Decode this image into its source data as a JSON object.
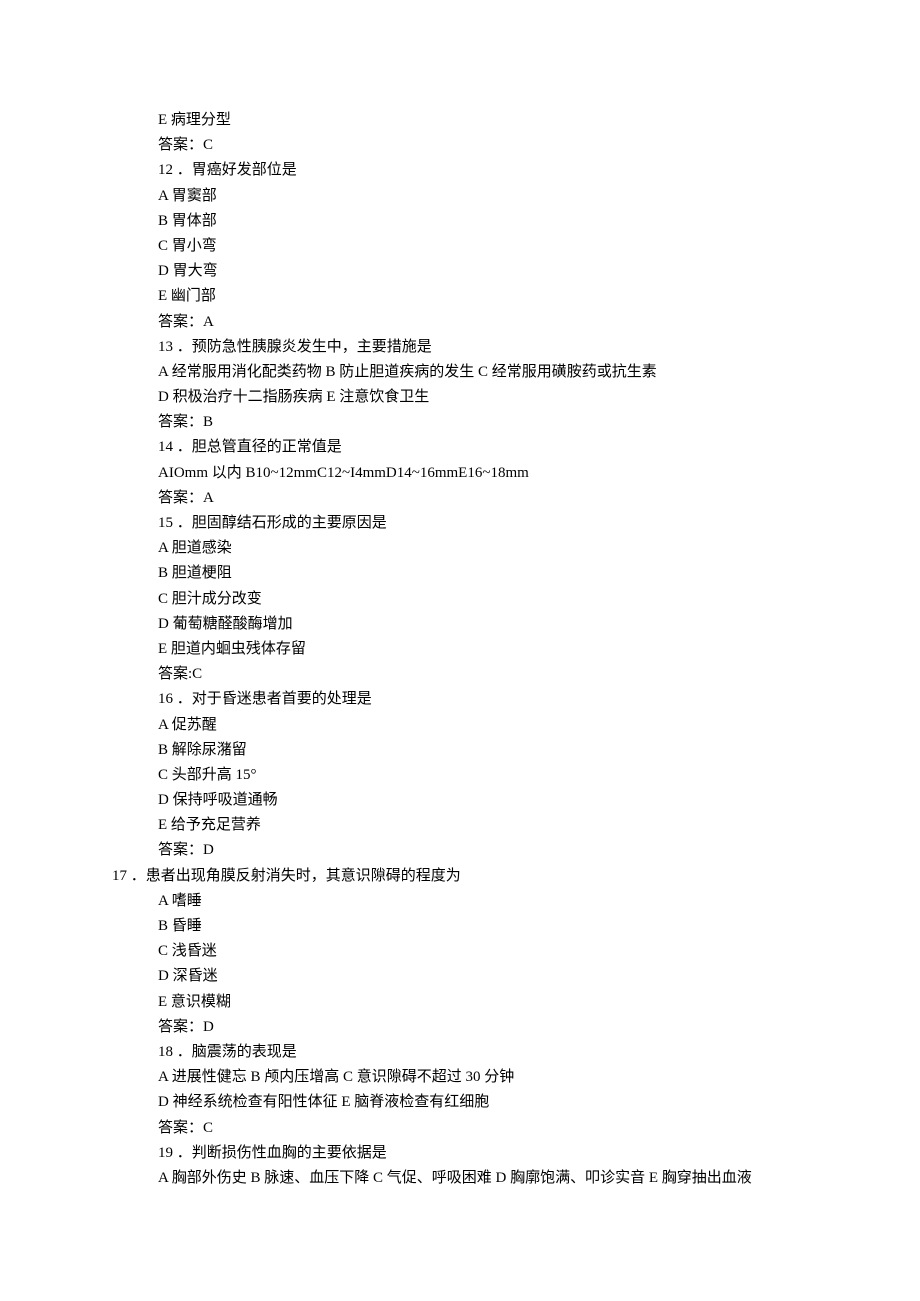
{
  "lines": [
    {
      "text": "E 病理分型",
      "outdent": false
    },
    {
      "text": "答案：C",
      "outdent": false
    },
    {
      "text": "12 ．胃癌好发部位是",
      "outdent": false
    },
    {
      "text": "A 胃窦部",
      "outdent": false
    },
    {
      "text": "B 胃体部",
      "outdent": false
    },
    {
      "text": "C 胃小弯",
      "outdent": false
    },
    {
      "text": "D 胃大弯",
      "outdent": false
    },
    {
      "text": "E 幽门部",
      "outdent": false
    },
    {
      "text": "答案：A",
      "outdent": false
    },
    {
      "text": "13 ．预防急性胰腺炎发生中，主要措施是",
      "outdent": false
    },
    {
      "text": "A 经常服用消化配类药物 B 防止胆道疾病的发生 C 经常服用磺胺药或抗生素",
      "outdent": false
    },
    {
      "text": "D 积极治疗十二指肠疾病 E 注意饮食卫生",
      "outdent": false
    },
    {
      "text": "答案：B",
      "outdent": false
    },
    {
      "text": "14 ．胆总管直径的正常值是",
      "outdent": false
    },
    {
      "text": "AIOmm 以内 B10~12mmC12~I4mmD14~16mmE16~18mm",
      "outdent": false
    },
    {
      "text": "答案：A",
      "outdent": false
    },
    {
      "text": "15 ．胆固醇结石形成的主要原因是",
      "outdent": false
    },
    {
      "text": "A 胆道感染",
      "outdent": false
    },
    {
      "text": "B 胆道梗阻",
      "outdent": false
    },
    {
      "text": "C 胆汁成分改变",
      "outdent": false
    },
    {
      "text": "D 葡萄糖醛酸酶增加",
      "outdent": false
    },
    {
      "text": "E 胆道内蛔虫残体存留",
      "outdent": false
    },
    {
      "text": "答案:C",
      "outdent": false
    },
    {
      "text": "16 ．对于昏迷患者首要的处理是",
      "outdent": false
    },
    {
      "text": "A 促苏醒",
      "outdent": false
    },
    {
      "text": "B 解除尿潴留",
      "outdent": false
    },
    {
      "text": "C 头部升高 15°",
      "outdent": false
    },
    {
      "text": "D 保持呼吸道通畅",
      "outdent": false
    },
    {
      "text": "E 给予充足营养",
      "outdent": false
    },
    {
      "text": "答案：D",
      "outdent": false
    },
    {
      "text": "17 ．患者出现角膜反射消失时，其意识隙碍的程度为",
      "outdent": true
    },
    {
      "text": "A 嗜睡",
      "outdent": false
    },
    {
      "text": "B 昏睡",
      "outdent": false
    },
    {
      "text": "C 浅昏迷",
      "outdent": false
    },
    {
      "text": "D 深昏迷",
      "outdent": false
    },
    {
      "text": "E 意识模糊",
      "outdent": false
    },
    {
      "text": "答案：D",
      "outdent": false
    },
    {
      "text": "18 ．脑震荡的表现是",
      "outdent": false
    },
    {
      "text": "A 进展性健忘 B 颅内压增高 C 意识隙碍不超过 30 分钟",
      "outdent": false
    },
    {
      "text": "D 神经系统检查有阳性体征 E 脑脊液检查有红细胞",
      "outdent": false
    },
    {
      "text": "答案：C",
      "outdent": false
    },
    {
      "text": "19 ．判断损伤性血胸的主要依据是",
      "outdent": false
    },
    {
      "text": "A 胸部外伤史 B 脉速、血压下降 C 气促、呼吸困难 D 胸廓饱满、叩诊实音 E 胸穿抽出血液",
      "outdent": false
    }
  ]
}
